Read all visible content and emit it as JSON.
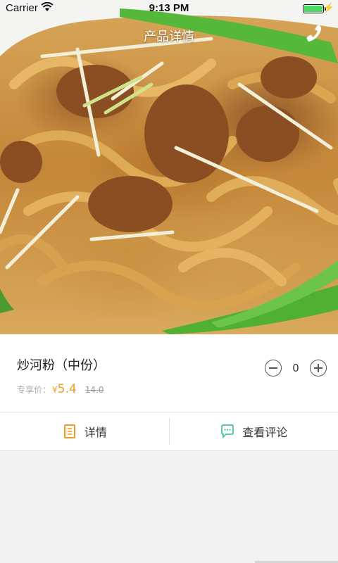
{
  "status_bar": {
    "carrier": "Carrier",
    "time": "9:13 PM"
  },
  "nav": {
    "title": "产品详情",
    "phone_icon": "phone-icon"
  },
  "product": {
    "name": "炒河粉（中份）",
    "price_label": "专享价：",
    "currency": "¥",
    "price": "5.4",
    "original_price": "14.0",
    "quantity": "0"
  },
  "tabs": [
    {
      "label": "详情",
      "icon": "document-icon",
      "color": "#f39c1f"
    },
    {
      "label": "查看评论",
      "icon": "comment-icon",
      "color": "#4cc2a0"
    }
  ],
  "colors": {
    "accent": "#f39c1f",
    "battery": "#4cd964"
  }
}
